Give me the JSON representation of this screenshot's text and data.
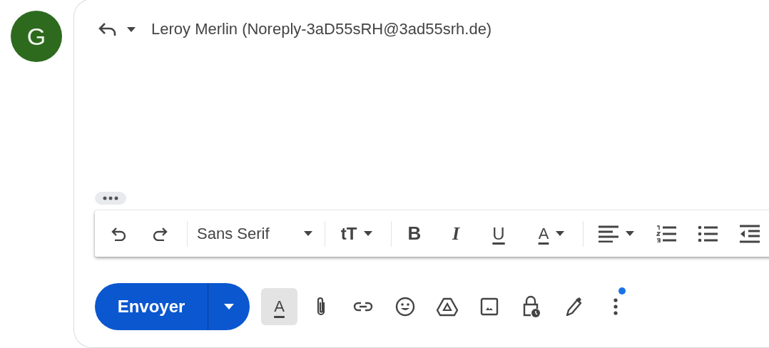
{
  "avatar": {
    "letter": "G"
  },
  "header": {
    "sender": "Leroy Merlin (Noreply-3aD55sRH@3ad55srh.de)"
  },
  "toolbar": {
    "font": "Sans Serif",
    "size_label": "tT",
    "bold": "B",
    "italic": "I",
    "underline": "U",
    "text_color": "A"
  },
  "actions": {
    "send": "Envoyer",
    "formatting": "A",
    "formatting_selected": true,
    "more_badge": true
  }
}
